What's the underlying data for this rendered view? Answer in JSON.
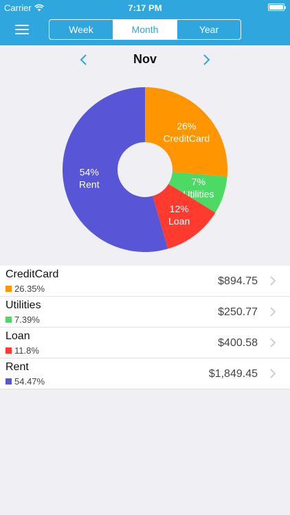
{
  "status_bar": {
    "carrier": "Carrier",
    "time": "7:17 PM"
  },
  "nav": {
    "segments": [
      {
        "label": "Week",
        "active": false
      },
      {
        "label": "Month",
        "active": true
      },
      {
        "label": "Year",
        "active": false
      }
    ]
  },
  "period": {
    "month": "Nov"
  },
  "chart_data": {
    "type": "pie",
    "donut": true,
    "slices": [
      {
        "name": "CreditCard",
        "value": 26.35,
        "label_pct": "26%",
        "color": "#ff9500"
      },
      {
        "name": "Utilities",
        "value": 7.39,
        "label_pct": "7%",
        "color": "#4cd964"
      },
      {
        "name": "Loan",
        "value": 11.8,
        "label_pct": "12%",
        "color": "#ff3b30"
      },
      {
        "name": "Rent",
        "value": 54.47,
        "label_pct": "54%",
        "color": "#5856d6"
      }
    ]
  },
  "categories": [
    {
      "name": "CreditCard",
      "percent": "26.35%",
      "amount": "$894.75",
      "color": "#ff9500"
    },
    {
      "name": "Utilities",
      "percent": "7.39%",
      "amount": "$250.77",
      "color": "#4cd964"
    },
    {
      "name": "Loan",
      "percent": "11.8%",
      "amount": "$400.58",
      "color": "#ff3b30"
    },
    {
      "name": "Rent",
      "percent": "54.47%",
      "amount": "$1,849.45",
      "color": "#5856d6"
    }
  ],
  "colors": {
    "nav_bg": "#2fa6de",
    "accent": "#2fa6de"
  },
  "icons": {
    "menu": "hamburger-menu-icon",
    "prev": "chevron-left-icon",
    "next": "chevron-right-icon",
    "wifi": "wifi-icon",
    "battery": "battery-icon",
    "row_chevron": "chevron-right-icon"
  }
}
